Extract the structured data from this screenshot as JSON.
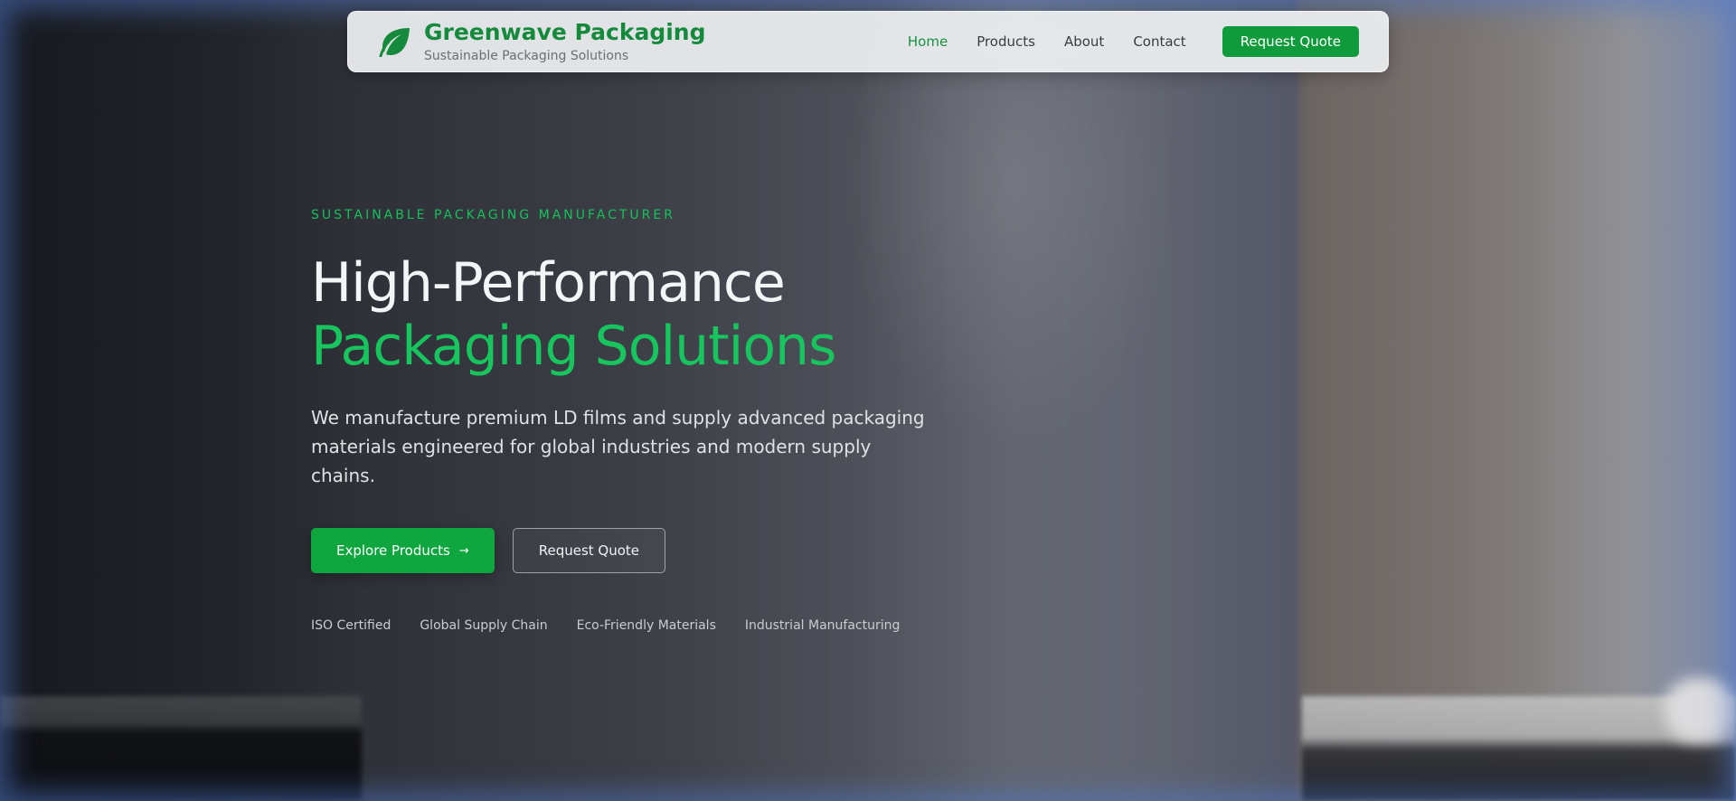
{
  "header": {
    "brand_name": "Greenwave Packaging",
    "brand_tagline": "Sustainable Packaging Solutions",
    "logo_icon": "leaf-icon",
    "nav": [
      {
        "label": "Home",
        "active": true
      },
      {
        "label": "Products",
        "active": false
      },
      {
        "label": "About",
        "active": false
      },
      {
        "label": "Contact",
        "active": false
      }
    ],
    "cta_label": "Request Quote"
  },
  "hero": {
    "eyebrow": "SUSTAINABLE PACKAGING MANUFACTURER",
    "headline_line1": "High-Performance",
    "headline_line2": "Packaging Solutions",
    "description": "We manufacture premium LD films and supply advanced packaging materials engineered for global industries and modern supply chains.",
    "primary_button": "Explore Products",
    "primary_button_arrow": "→",
    "secondary_button": "Request Quote",
    "badges": [
      "ISO Certified",
      "Global Supply Chain",
      "Eco-Friendly Materials",
      "Industrial Manufacturing"
    ]
  },
  "colors": {
    "brand_green": "#158a3c",
    "accent_green": "#17c45e",
    "button_green": "#0fa53f",
    "navbar_bg": "#eef0f2"
  }
}
